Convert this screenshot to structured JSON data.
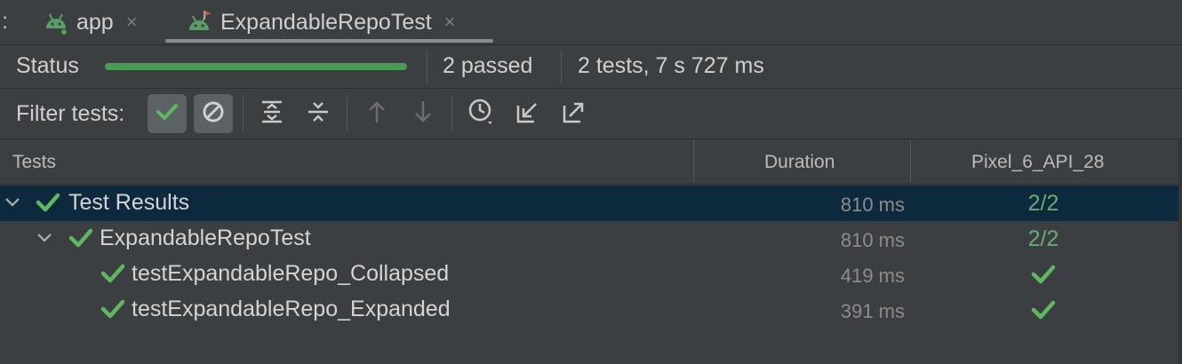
{
  "tabs": {
    "overflow_label": ":",
    "items": [
      {
        "label": "app",
        "icon": "android-icon"
      },
      {
        "label": "ExpandableRepoTest",
        "icon": "android-test-icon"
      }
    ],
    "close_glyph": "×"
  },
  "status": {
    "label": "Status",
    "progress_fraction": 1.0,
    "passed_text": "2 passed",
    "summary_text": "2 tests, 7 s 727 ms"
  },
  "filter": {
    "label": "Filter tests:",
    "buttons": [
      "show-passed-icon",
      "show-ignored-icon",
      "expand-all-icon",
      "collapse-all-icon",
      "previous-failed-icon",
      "next-failed-icon",
      "history-icon",
      "import-icon",
      "export-icon"
    ]
  },
  "table": {
    "columns": [
      "Tests",
      "Duration",
      "Pixel_6_API_28"
    ],
    "rows": [
      {
        "name": "Test Results",
        "duration": "810 ms",
        "result": "2/2",
        "expandable": true
      },
      {
        "name": "ExpandableRepoTest",
        "duration": "810 ms",
        "result": "2/2",
        "expandable": true
      },
      {
        "name": "testExpandableRepo_Collapsed",
        "duration": "419 ms",
        "result": "check-icon",
        "expandable": false
      },
      {
        "name": "testExpandableRepo_Expanded",
        "duration": "391 ms",
        "result": "check-icon",
        "expandable": false
      }
    ]
  },
  "colors": {
    "accent_green": "#499c54",
    "selection": "#0d293e",
    "background": "#3c3f41"
  }
}
